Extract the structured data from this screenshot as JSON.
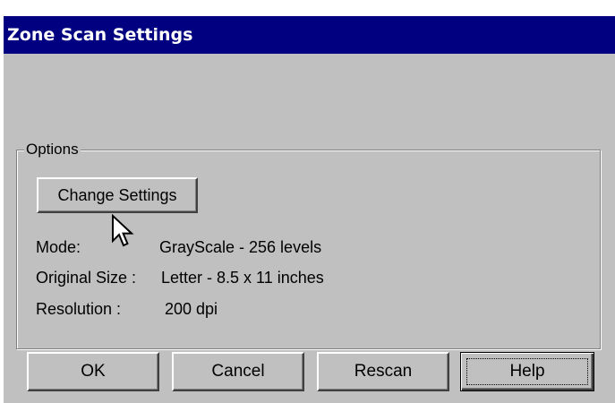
{
  "window": {
    "title": "Zone Scan Settings"
  },
  "options": {
    "group_label": "Options",
    "change_settings_label": "Change Settings",
    "mode_label": "Mode:",
    "mode_value": "GrayScale - 256 levels",
    "original_size_label": "Original Size :",
    "original_size_value": "Letter - 8.5 x 11 inches",
    "resolution_label": "Resolution :",
    "resolution_value": "200 dpi"
  },
  "buttons": {
    "ok_label": "OK",
    "cancel_label": "Cancel",
    "rescan_label": "Rescan",
    "help_label": "Help"
  },
  "colors": {
    "titlebar": "#000080",
    "face": "#c0c0c0"
  },
  "icons": {
    "cursor": "mouse-pointer-icon"
  }
}
